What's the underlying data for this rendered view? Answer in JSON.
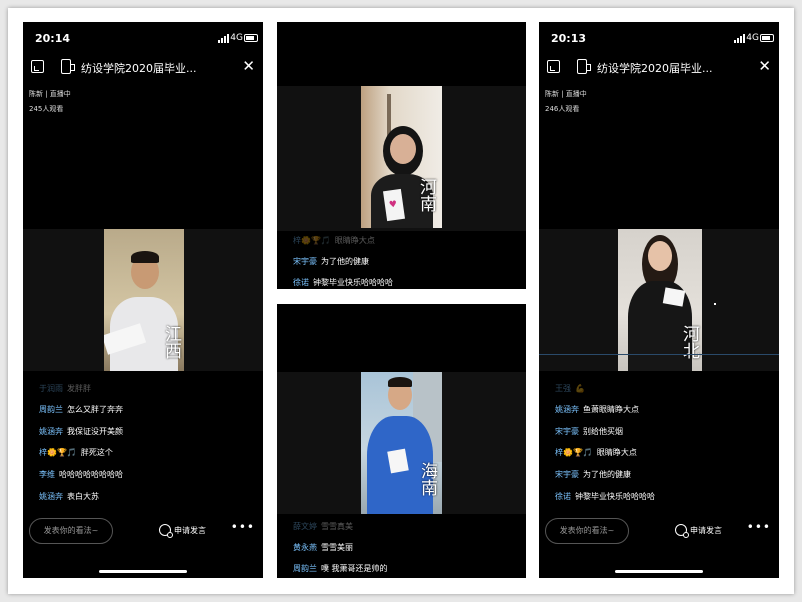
{
  "panels": [
    {
      "time": "20:14",
      "network": "4G",
      "title": "纺设学院2020届毕业...",
      "host": "陈新 | 直播中",
      "viewers": "245人观看",
      "overlay": "江西",
      "comments": [
        {
          "user": "于润雨",
          "text": "发胖胖",
          "faded": true
        },
        {
          "user": "周韵兰",
          "text": "怎么又胖了奔奔"
        },
        {
          "user": "姚涵奔",
          "text": "我保证没开美颜"
        },
        {
          "user": "梓🌼🏆🎵",
          "text": "胖死这个"
        },
        {
          "user": "李维",
          "text": "哈哈哈哈哈哈哈哈"
        },
        {
          "user": "姚涵奔",
          "text": "表白大苏"
        }
      ],
      "input_placeholder": "发表你的看法~",
      "apply_label": "申请发言",
      "more_label": "•••"
    },
    {
      "overlay": "河南",
      "comments": [
        {
          "user": "梓🌼🏆🎵",
          "text": "眼睛睁大点",
          "faded": true
        },
        {
          "user": "宋宇豪",
          "text": "为了他的健康"
        },
        {
          "user": "徐诺",
          "text": "钟黎毕业快乐哈哈哈哈"
        }
      ]
    },
    {
      "overlay": "海南",
      "comments": [
        {
          "user": "薛文婷",
          "text": "雪雪真美",
          "faded": true
        },
        {
          "user": "黄永燕",
          "text": "雪雪美丽"
        },
        {
          "user": "周韵兰",
          "text": "噗 我萧哥还是帅的"
        }
      ]
    },
    {
      "time": "20:13",
      "network": "4G",
      "title": "纺设学院2020届毕业...",
      "host": "陈新 | 直播中",
      "viewers": "246人观看",
      "overlay": "河北",
      "comments": [
        {
          "user": "王强",
          "text": "💪",
          "faded": true
        },
        {
          "user": "姚涵奔",
          "text": "鱼萧眼睛睁大点"
        },
        {
          "user": "宋宇豪",
          "text": "别给他买烟"
        },
        {
          "user": "梓🌼🏆🎵",
          "text": "眼睛睁大点"
        },
        {
          "user": "宋宇豪",
          "text": "为了他的健康"
        },
        {
          "user": "徐诺",
          "text": "钟黎毕业快乐哈哈哈哈"
        }
      ],
      "input_placeholder": "发表你的看法~",
      "apply_label": "申请发言",
      "more_label": "•••"
    }
  ],
  "colors": {
    "username": "#7cc4ff",
    "background": "#000000"
  }
}
